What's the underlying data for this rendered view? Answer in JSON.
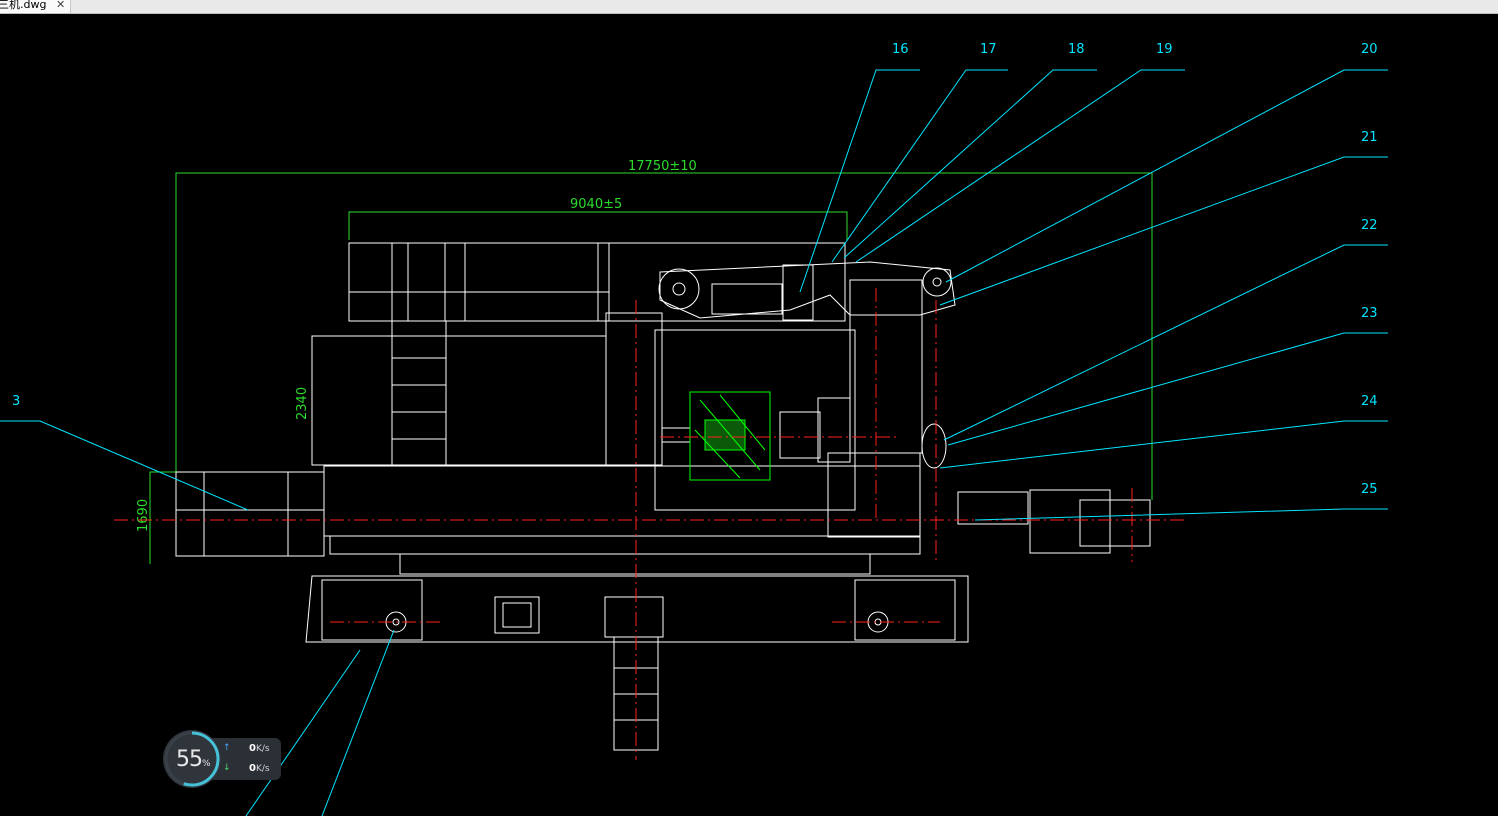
{
  "tab": {
    "title": "三机.dwg",
    "close": "✕"
  },
  "balloons": [
    "16",
    "17",
    "18",
    "19",
    "20",
    "21",
    "22",
    "23",
    "24",
    "25",
    "3"
  ],
  "dims": {
    "overall": "17750±10",
    "upper": "9040±5",
    "height": "2340",
    "base": "1690"
  },
  "colors": {
    "bg": "#000000",
    "geometry": "#ffffff",
    "leader": "#00e5ff",
    "dimension": "#2bdc2b",
    "centerline": "#ff2020",
    "hatch": "#00ff00"
  },
  "net": {
    "percent": "55",
    "percent_unit": "%",
    "up": "0",
    "down": "0",
    "unit": "K/s"
  }
}
